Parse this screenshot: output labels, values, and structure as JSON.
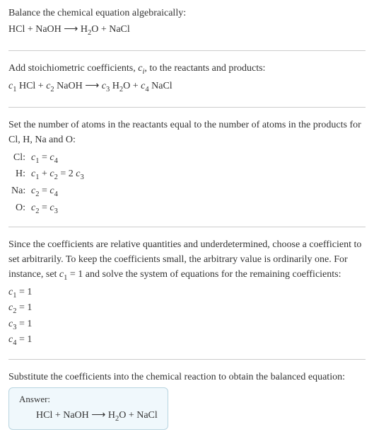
{
  "intro": {
    "title": "Balance the chemical equation algebraically:",
    "equation": "HCl + NaOH ⟶ H",
    "equation_sub": "2",
    "equation_tail": "O + NaCl"
  },
  "stoich": {
    "title_a": "Add stoichiometric coefficients, ",
    "c": "c",
    "i": "i",
    "title_b": ", to the reactants and products:",
    "c1": "c",
    "s1": "1",
    "t1": " HCl + ",
    "c2": "c",
    "s2": "2",
    "t2": " NaOH ⟶ ",
    "c3": "c",
    "s3": "3",
    "t3": " H",
    "h2": "2",
    "t4": "O + ",
    "c4": "c",
    "s4": "4",
    "t5": " NaCl"
  },
  "atoms": {
    "title": "Set the number of atoms in the reactants equal to the number of atoms in the products for Cl, H, Na and O:",
    "rows": [
      {
        "label": "Cl:",
        "c1": "c",
        "s1": "1",
        "mid": " = ",
        "c2": "c",
        "s2": "4",
        "tail": ""
      },
      {
        "label": "H:",
        "c1": "c",
        "s1": "1",
        "mid": " + ",
        "c2": "c",
        "s2": "2",
        "tail_a": " = 2 ",
        "c3": "c",
        "s3": "3"
      },
      {
        "label": "Na:",
        "c1": "c",
        "s1": "2",
        "mid": " = ",
        "c2": "c",
        "s2": "4",
        "tail": ""
      },
      {
        "label": "O:",
        "c1": "c",
        "s1": "2",
        "mid": " = ",
        "c2": "c",
        "s2": "3",
        "tail": ""
      }
    ]
  },
  "solve": {
    "title_a": "Since the coefficients are relative quantities and underdetermined, choose a coefficient to set arbitrarily. To keep the coefficients small, the arbitrary value is ordinarily one. For instance, set ",
    "c": "c",
    "s": "1",
    "title_b": " = 1 and solve the system of equations for the remaining coefficients:",
    "coefs": [
      {
        "c": "c",
        "s": "1",
        "val": " = 1"
      },
      {
        "c": "c",
        "s": "2",
        "val": " = 1"
      },
      {
        "c": "c",
        "s": "3",
        "val": " = 1"
      },
      {
        "c": "c",
        "s": "4",
        "val": " = 1"
      }
    ]
  },
  "substitute": {
    "title": "Substitute the coefficients into the chemical reaction to obtain the balanced equation:"
  },
  "answer": {
    "label": "Answer:",
    "eq_a": "HCl + NaOH ⟶ H",
    "eq_sub": "2",
    "eq_b": "O + NaCl"
  }
}
